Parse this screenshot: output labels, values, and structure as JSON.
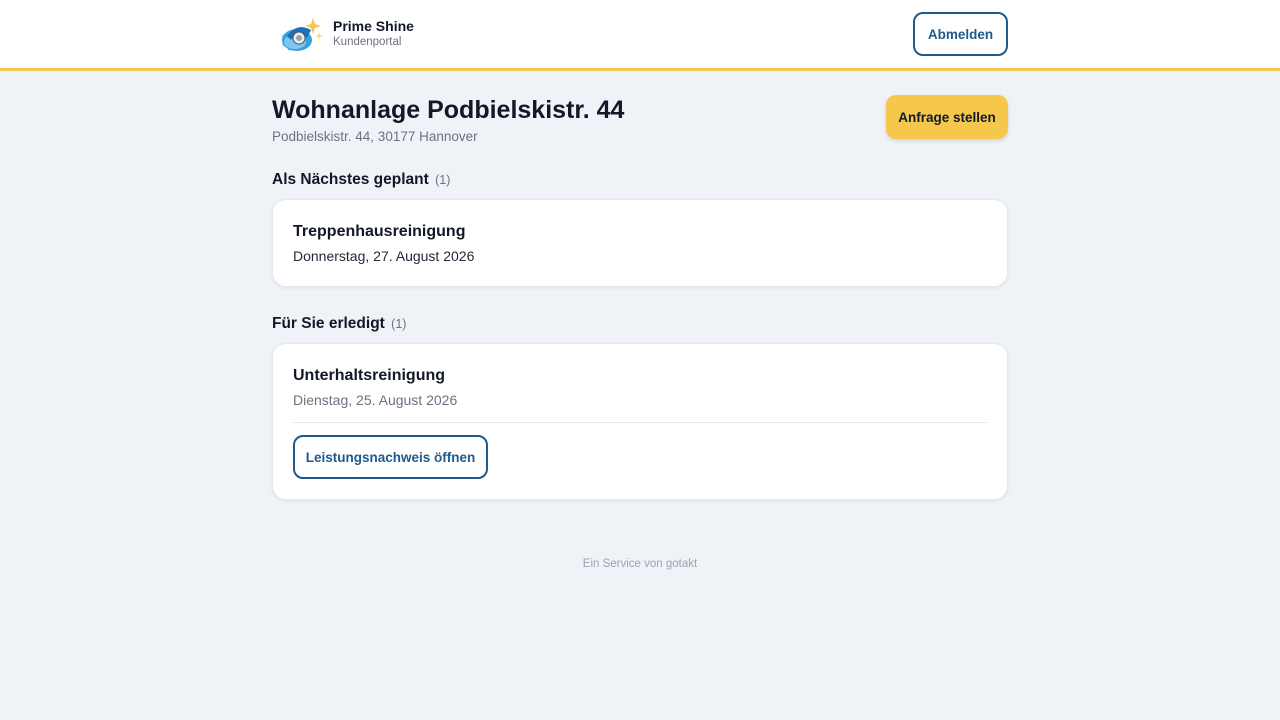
{
  "header": {
    "brand_name": "Prime Shine",
    "brand_subtitle": "Kundenportal",
    "logout_label": "Abmelden",
    "logo_icon": "prime-shine-logo",
    "accent_color": "#f5c84b"
  },
  "page": {
    "title": "Wohnanlage Podbielskistr. 44",
    "address": "Podbielskistr. 44, 30177 Hannover",
    "request_button_label": "Anfrage stellen"
  },
  "sections": {
    "next": {
      "heading": "Als Nächstes geplant",
      "count": "(1)",
      "items": [
        {
          "title": "Treppenhausreinigung",
          "date": "Donnerstag, 27. August 2026"
        }
      ]
    },
    "done": {
      "heading": "Für Sie erledigt",
      "count": "(1)",
      "items": [
        {
          "title": "Unterhaltsreinigung",
          "date": "Dienstag, 25. August 2026",
          "button_label": "Leistungsnachweis öffnen"
        }
      ]
    }
  },
  "footer": {
    "text": "Ein Service von gotakt"
  },
  "colors": {
    "primary": "#1e5a8e",
    "accent": "#f5c84b",
    "background": "#eff3f8"
  }
}
